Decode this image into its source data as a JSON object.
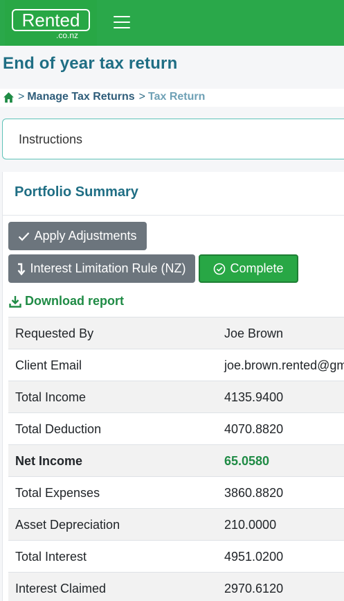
{
  "header": {
    "logo_text": "Rented",
    "logo_sub": ".co.nz",
    "brand_color": "#2aa84a"
  },
  "page": {
    "title": "End of year tax return"
  },
  "breadcrumb": {
    "link": "Manage Tax Returns",
    "current": "Tax Return",
    "separator": ">"
  },
  "instructions": {
    "label": "Instructions"
  },
  "portfolio": {
    "title": "Portfolio Summary",
    "apply_label": "Apply Adjustments",
    "interest_label": "Interest Limitation Rule (NZ)",
    "complete_label": "Complete",
    "download_label": "Download report"
  },
  "table": {
    "rows": [
      {
        "label": "Requested By",
        "value": "Joe Brown"
      },
      {
        "label": "Client Email",
        "value": "joe.brown.rented@gm"
      },
      {
        "label": "Total Income",
        "value": "4135.9400"
      },
      {
        "label": "Total Deduction",
        "value": "4070.8820"
      },
      {
        "label": "Net Income",
        "value": "65.0580"
      },
      {
        "label": "Total Expenses",
        "value": "3860.8820"
      },
      {
        "label": "Asset Depreciation",
        "value": "210.0000"
      },
      {
        "label": "Total Interest",
        "value": "4951.0200"
      },
      {
        "label": "Interest Claimed",
        "value": "2970.6120"
      }
    ]
  }
}
